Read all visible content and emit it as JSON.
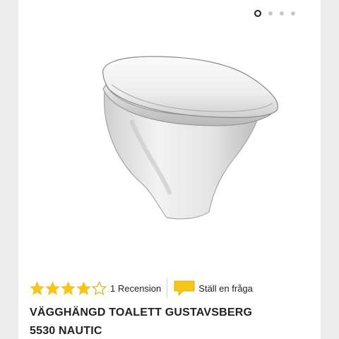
{
  "carousel": {
    "count": 4,
    "active": 0
  },
  "product": {
    "rating": 4,
    "rating_max": 5,
    "review_count_label": "1 Recension",
    "ask_label": "Ställ en fråga",
    "title_line1": "VÄGGHÄNGD TOALETT GUSTAVSBERG",
    "title_line2": "5530 NAUTIC"
  },
  "colors": {
    "star": "#f5c518",
    "star_empty_stroke": "#e0b000",
    "chat_icon": "#f5c518"
  },
  "icons": {
    "ask": "chat-bubble-icon",
    "rating": "star-icon"
  }
}
